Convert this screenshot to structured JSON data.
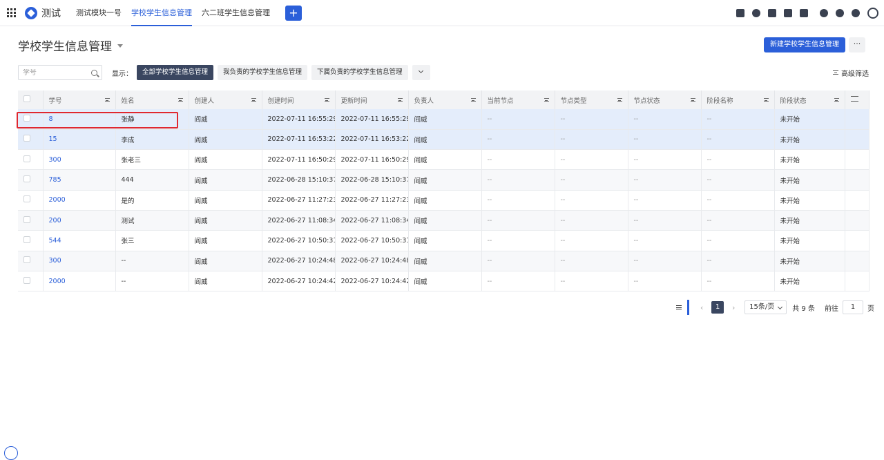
{
  "topnav": {
    "app_name": "测试",
    "tabs": [
      {
        "label": "测试模块一号",
        "active": false
      },
      {
        "label": "学校学生信息管理",
        "active": true
      },
      {
        "label": "六二班学生信息管理",
        "active": false
      }
    ],
    "plus_label": "+",
    "icons": [
      "calendar-check-icon",
      "person-icon",
      "document-icon",
      "card-icon",
      "calendar-icon",
      "bell-icon",
      "help-icon",
      "gear-icon",
      "user-avatar-icon"
    ]
  },
  "header": {
    "title": "学校学生信息管理",
    "new_button": "新建学校学生信息管理",
    "more_button": "···"
  },
  "filters": {
    "search_placeholder": "学号",
    "show_label": "显示：",
    "buttons": [
      "全部学校学生信息管理",
      "我负责的学校学生信息管理",
      "下属负责的学校学生信息管理"
    ],
    "advanced": "高级筛选"
  },
  "table": {
    "columns": [
      "学号",
      "姓名",
      "创建人",
      "创建时间",
      "更新时间",
      "负责人",
      "当前节点",
      "节点类型",
      "节点状态",
      "阶段名称",
      "阶段状态"
    ],
    "rows": [
      [
        "8",
        "张静",
        "阎威",
        "2022-07-11 16:55:29",
        "2022-07-11 16:55:29",
        "阎威",
        "--",
        "--",
        "--",
        "--",
        "未开始"
      ],
      [
        "15",
        "李成",
        "阎威",
        "2022-07-11 16:53:22",
        "2022-07-11 16:53:22",
        "阎威",
        "--",
        "--",
        "--",
        "--",
        "未开始"
      ],
      [
        "300",
        "张老三",
        "阎威",
        "2022-07-11 16:50:29",
        "2022-07-11 16:50:29",
        "阎威",
        "--",
        "--",
        "--",
        "--",
        "未开始"
      ],
      [
        "785",
        "444",
        "阎威",
        "2022-06-28 15:10:37",
        "2022-06-28 15:10:37",
        "阎威",
        "--",
        "--",
        "--",
        "--",
        "未开始"
      ],
      [
        "2000",
        "是的",
        "阎威",
        "2022-06-27 11:27:23",
        "2022-06-27 11:27:23",
        "阎威",
        "--",
        "--",
        "--",
        "--",
        "未开始"
      ],
      [
        "200",
        "测试",
        "阎威",
        "2022-06-27 11:08:34",
        "2022-06-27 11:08:34",
        "阎威",
        "--",
        "--",
        "--",
        "--",
        "未开始"
      ],
      [
        "544",
        "张三",
        "阎威",
        "2022-06-27 10:50:31",
        "2022-06-27 10:50:31",
        "阎威",
        "--",
        "--",
        "--",
        "--",
        "未开始"
      ],
      [
        "300",
        "--",
        "阎威",
        "2022-06-27 10:24:48",
        "2022-06-27 10:24:48",
        "阎威",
        "--",
        "--",
        "--",
        "--",
        "未开始"
      ],
      [
        "2000",
        "--",
        "阎威",
        "2022-06-27 10:24:42",
        "2022-06-27 10:24:42",
        "阎威",
        "--",
        "--",
        "--",
        "--",
        "未开始"
      ]
    ],
    "selected_rows": [
      0,
      1
    ]
  },
  "pagination": {
    "current_page": "1",
    "page_size": "15条/页",
    "total": "共 9 条",
    "goto_label": "前往",
    "goto_value": "1",
    "page_suffix": "页"
  },
  "colors": {
    "accent": "#2b5fd9",
    "dark_button": "#3a4660",
    "highlight_border": "#e0282f"
  }
}
